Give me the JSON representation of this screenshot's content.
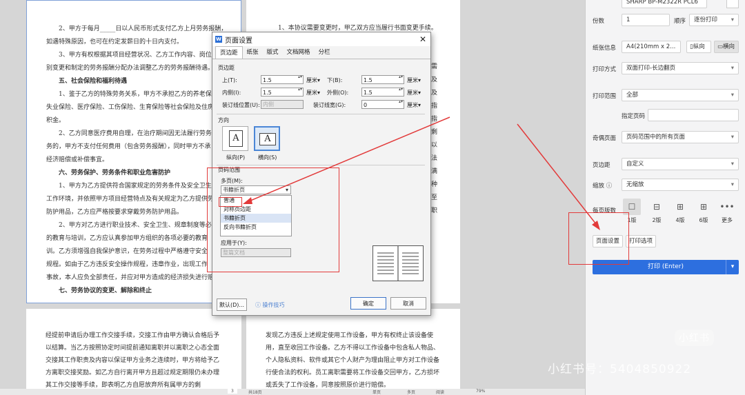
{
  "doc_left_top": {
    "lines": [
      "2、甲方于每月_____日以人民币形式支付乙方上月劳务报酬，",
      "如遇特殊原因，也可在约定发薪日的十日内支付。",
      "3、甲方有权根据其项目经营状况、乙方工作内容、岗位",
      "别变更和制定的劳务报酬分配办法调整乙方的劳务报酬待遇。",
      "五、社会保险和福利待遇",
      "1、鉴于乙方的特殊劳务关系，甲方不承担乙方的养老保险",
      "失业保险、医疗保险、工伤保险、生育保险等社会保险及住房",
      "积金。",
      "2、乙方同意医疗费用自理，在治疗期间因无法履行劳务",
      "务的，甲方不支付任何费用（包含劳务报酬），同时甲方不承",
      "经济赔偿或补偿事宜。",
      "六、劳务保护、劳务条件和职业危害防护",
      "1、甲方为乙方提供符合国家规定的劳务条件及安全卫生",
      "工作环境，并依照甲方项目经营特点及有关规定为乙方提供劳",
      "防护用品，乙方应严格按要求穿戴劳务防护用品。",
      "2、甲方对乙方进行职业技术、安全卫生、规章制度等必",
      "的教育与培训，乙方应认真参加甲方组织的各项必要的教育",
      "训。乙方须增强自我保护意识，在劳务过程中严格遵守安全",
      "规程。如由于乙方违反安全操作规程，违章作业，出现工作",
      "事故，本人应负全部责任，并应对甲方造成的经济损失进行赔",
      "七、劳务协议的变更、解除和终止"
    ]
  },
  "doc_right_top": {
    "lines": [
      "1、本协议需要变更时，甲乙双方应当履行书面变更手续。"
    ],
    "edge_chars": [
      "需",
      "及",
      "及",
      "指",
      "指",
      "剩",
      "以",
      "法",
      "满",
      "种",
      "至",
      "职"
    ]
  },
  "doc_left_bottom": {
    "lines": [
      "经提前申请后办理工作交接手续，交接工作由甲方确认合格后予",
      "以结算。当乙方按照协定时间提前通知离职并以离职之心态全面",
      "交接其工作职责及内容以保证甲方业务之连续时，甲方将给予乙",
      "方离职交接奖励。如乙方自行离开甲方且超过规定期限仍未办理",
      "其工作交接等手续，即表明乙方自愿放弃所有属甲方的剩"
    ]
  },
  "doc_right_bottom": {
    "lines": [
      "发现乙方违反上述规定使用工作设备，甲方有权终止该设备使",
      "用，直至收回工作设备。乙方不得以工作设备中包含私人物品、",
      "个人隐私资料、软件或其它个人财产为理由阻止甲方对工作设备",
      "行使合法的权利。员工离职需要将工作设备交回甲方，乙方损坏",
      "或丢失了工作设备，同意按照原价进行赔偿。"
    ]
  },
  "dialog": {
    "title": "页面设置",
    "close": "✕",
    "tabs": [
      "页边距",
      "纸张",
      "版式",
      "文档网格",
      "分栏"
    ],
    "margins_section": "页边距",
    "top_label": "上(T):",
    "top_value": "1.5",
    "bottom_label": "下(B):",
    "bottom_value": "1.5",
    "inner_label": "内侧(I):",
    "inner_value": "1.5",
    "outer_label": "外侧(O):",
    "outer_value": "1.5",
    "gutter_pos_label": "装订线位置(U):",
    "gutter_pos_value": "内侧",
    "gutter_width_label": "装订线宽(G):",
    "gutter_width_value": "0",
    "unit": "厘米▾",
    "orientation_section": "方向",
    "portrait_label": "纵向(P)",
    "landscape_label": "横向(S)",
    "orientation_glyph": "A",
    "pages_section": "页码范围",
    "multi_pages_label": "多页(M):",
    "multi_pages_value": "书籍折页",
    "dropdown_options": [
      "普通",
      "对称页边距",
      "书籍折页",
      "反向书籍折页"
    ],
    "apply_label": "应用于(Y):",
    "apply_value": "整篇文档",
    "default_button": "默认(D)...",
    "tips_label": "操作技巧",
    "ok_button": "确定",
    "cancel_button": "取消"
  },
  "panel": {
    "printer_value": "SHARP BP-M2322R PCL6",
    "copies_label": "份数",
    "copies_value": "1",
    "order_label": "顺序",
    "order_value": "逐份打印",
    "paper_label": "纸张信息",
    "paper_value": "A4(210mm x 2...",
    "portrait_btn": "纵向",
    "landscape_btn": "横向",
    "print_mode_label": "打印方式",
    "print_mode_value": "双面打印-长边翻页",
    "range_label": "打印范围",
    "range_value": "全部",
    "pages_label": "指定页码",
    "odd_even_label": "奇偶页面",
    "odd_even_value": "页码范围中的所有页面",
    "margin_label": "页边距",
    "margin_value": "自定义",
    "scale_label": "缩放",
    "scale_value": "无缩放",
    "per_page_label": "每页版数",
    "layouts": [
      {
        "label": "1版",
        "icon": "single-page-icon",
        "glyph": "☐"
      },
      {
        "label": "2版",
        "icon": "two-up-icon",
        "glyph": "⊟"
      },
      {
        "label": "4版",
        "icon": "four-up-icon",
        "glyph": "⊞"
      },
      {
        "label": "6版",
        "icon": "six-up-icon",
        "glyph": "⊞"
      },
      {
        "label": "更多",
        "icon": "more-icon",
        "glyph": "•••"
      }
    ],
    "page_setup_btn": "页面设置",
    "print_options_btn": "打印选项",
    "print_btn": "打印 (Enter)"
  },
  "bottom_bar": {
    "page_num": "3",
    "items": [
      "共18页",
      "单页",
      "多页",
      "阅读",
      "79%"
    ]
  },
  "watermark": {
    "logo": "小红书",
    "id_text": "小红书号：5404850922"
  },
  "colors": {
    "accent": "#2d6fdf",
    "annotation": "#e23a3a"
  }
}
